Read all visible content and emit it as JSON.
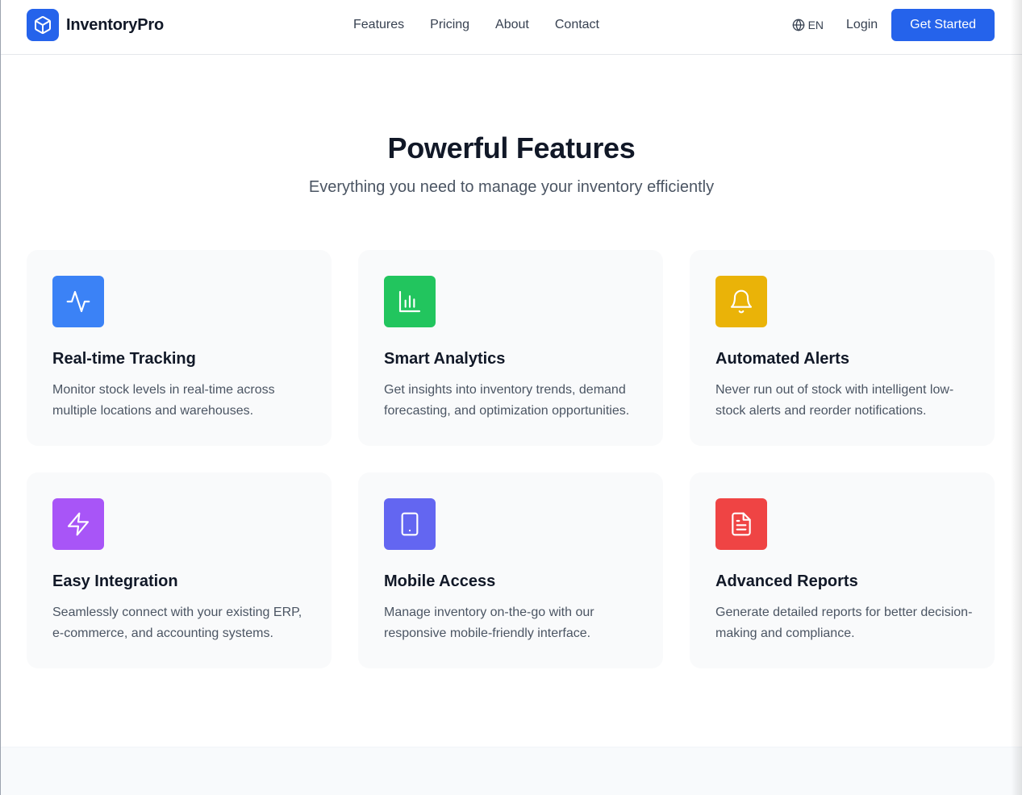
{
  "brand": {
    "name": "InventoryPro",
    "logo_icon": "box-icon",
    "accent": "#2563eb"
  },
  "nav": {
    "links": [
      "Features",
      "Pricing",
      "About",
      "Contact"
    ],
    "language": "EN",
    "login": "Login",
    "cta": "Get Started"
  },
  "features_section": {
    "title": "Powerful Features",
    "subtitle": "Everything you need to manage your inventory efficiently",
    "cards": [
      {
        "title": "Real-time Tracking",
        "description": "Monitor stock levels in real-time across multiple locations and warehouses.",
        "icon": "activity-icon",
        "color": "#3b82f6"
      },
      {
        "title": "Smart Analytics",
        "description": "Get insights into inventory trends, demand forecasting, and optimization opportunities.",
        "icon": "bar-chart-icon",
        "color": "#22c55e"
      },
      {
        "title": "Automated Alerts",
        "description": "Never run out of stock with intelligent low-stock alerts and reorder notifications.",
        "icon": "bell-icon",
        "color": "#eab308"
      },
      {
        "title": "Easy Integration",
        "description": "Seamlessly connect with your existing ERP, e-commerce, and accounting systems.",
        "icon": "zap-icon",
        "color": "#a855f7"
      },
      {
        "title": "Mobile Access",
        "description": "Manage inventory on-the-go with our responsive mobile-friendly interface.",
        "icon": "smartphone-icon",
        "color": "#6366f1"
      },
      {
        "title": "Advanced Reports",
        "description": "Generate detailed reports for better decision-making and compliance.",
        "icon": "file-text-icon",
        "color": "#ef4444"
      }
    ]
  }
}
